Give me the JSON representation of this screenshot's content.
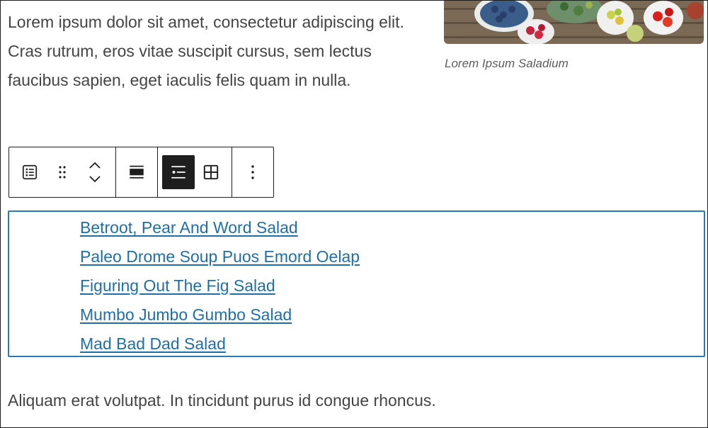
{
  "intro_paragraph": "Lorem ipsum dolor sit amet, consectetur adipiscing elit. Cras rutrum, eros vitae suscipit cursus, sem lectus faucibus sapien, eget iaculis felis quam in nulla.",
  "image": {
    "caption": "Lorem Ipsum Saladium"
  },
  "toolbar": {
    "buttons": [
      {
        "icon": "latest-posts-block-icon"
      },
      {
        "icon": "drag-handle-icon"
      },
      {
        "icon": "move-up-icon"
      },
      {
        "icon": "move-down-icon"
      },
      {
        "icon": "align-icon"
      },
      {
        "icon": "list-view-icon",
        "active": true
      },
      {
        "icon": "grid-view-icon"
      },
      {
        "icon": "more-options-icon"
      }
    ]
  },
  "posts_list": [
    "Betroot, Pear And Word Salad",
    "Paleo Drome Soup Puos Emord Oelap",
    "Figuring Out The Fig Salad",
    "Mumbo Jumbo Gumbo Salad",
    "Mad Bad Dad Salad"
  ],
  "outro_paragraph": "Aliquam erat volutpat. In tincidunt purus id congue rhoncus.",
  "colors": {
    "text": "#444444",
    "link": "#1f6fa6",
    "selection_border": "#2a7bb2",
    "toolbar_border": "#1e1e1e",
    "active_button": "#1e1e1e"
  }
}
